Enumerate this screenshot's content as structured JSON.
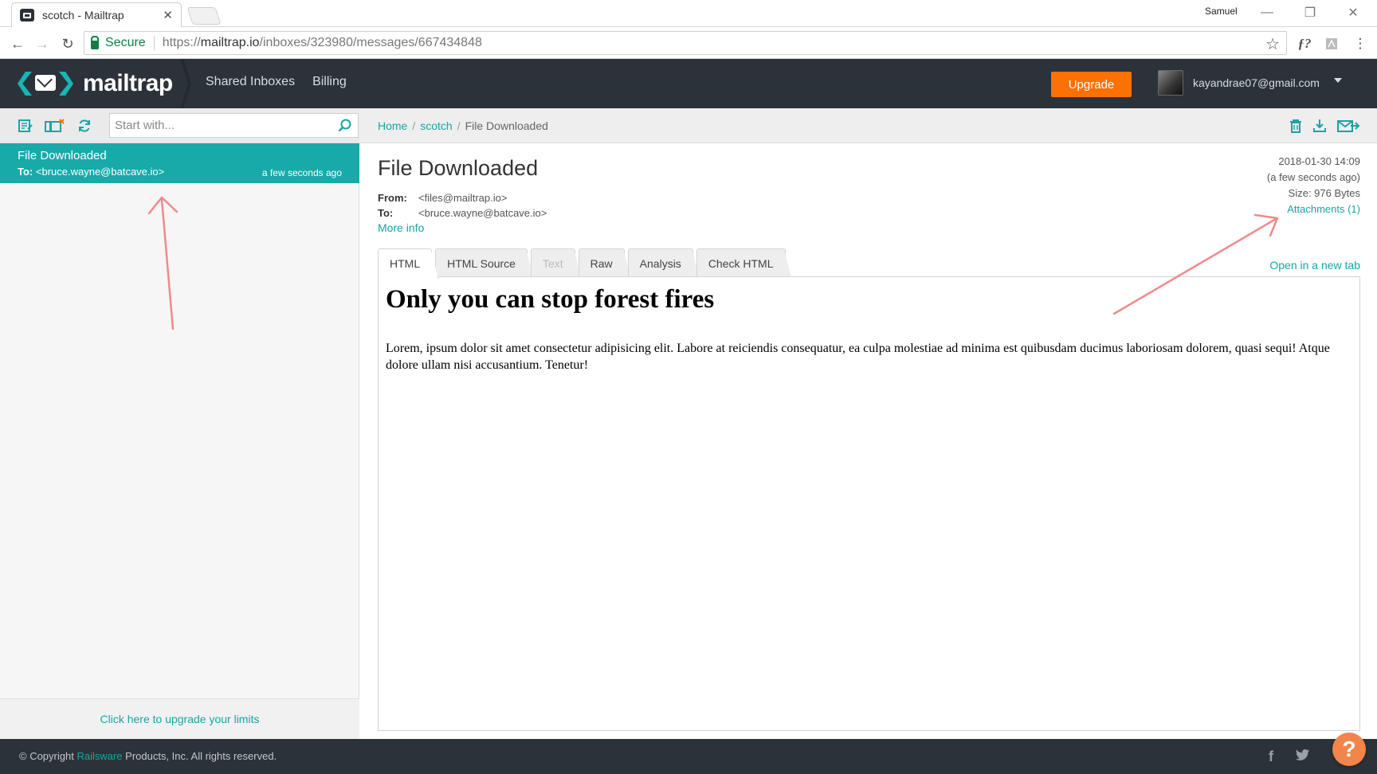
{
  "browser": {
    "tab_title": "scotch - Mailtrap",
    "profile_name": "Samuel",
    "secure_label": "Secure",
    "url_scheme": "https://",
    "url_host": "mailtrap.io",
    "url_path": "/inboxes/323980/messages/667434848"
  },
  "header": {
    "logo_text": "mailtrap",
    "nav": [
      "Shared Inboxes",
      "Billing"
    ],
    "upgrade_label": "Upgrade",
    "user_email": "kayandrae07@gmail.com"
  },
  "sidebar": {
    "search_placeholder": "Start with...",
    "messages": [
      {
        "subject": "File Downloaded",
        "to_label": "To:",
        "to": "<bruce.wayne@batcave.io>",
        "time": "a few seconds ago"
      }
    ],
    "upgrade_limits": "Click here to upgrade your limits"
  },
  "main": {
    "breadcrumb": {
      "home": "Home",
      "inbox": "scotch",
      "current": "File Downloaded"
    },
    "message": {
      "title": "File Downloaded",
      "from_label": "From:",
      "from": "<files@mailtrap.io>",
      "to_label": "To:",
      "to": "<bruce.wayne@batcave.io>",
      "more_info": "More info",
      "date": "2018-01-30 14:09",
      "relative_time": "(a few seconds ago)",
      "size": "Size: 976 Bytes",
      "attachments": "Attachments (1)"
    },
    "tabs": [
      {
        "label": "HTML",
        "state": "active"
      },
      {
        "label": "HTML Source",
        "state": "normal"
      },
      {
        "label": "Text",
        "state": "disabled"
      },
      {
        "label": "Raw",
        "state": "normal"
      },
      {
        "label": "Analysis",
        "state": "normal"
      },
      {
        "label": "Check HTML",
        "state": "normal"
      }
    ],
    "open_new_tab": "Open in a new tab",
    "preview": {
      "heading": "Only you can stop forest fires",
      "body": "Lorem, ipsum dolor sit amet consectetur adipisicing elit. Labore at reiciendis consequatur, ea culpa molestiae ad minima est quibusdam ducimus laboriosam dolorem, quasi sequi! Atque dolore ullam nisi accusantium. Tenetur!"
    }
  },
  "footer": {
    "copyright_prefix": "© Copyright ",
    "company": "Railsware",
    "copyright_suffix": " Products, Inc. All rights reserved."
  },
  "help_label": "?",
  "colors": {
    "accent": "#17aaa9",
    "header_bg": "#2c3239",
    "upgrade": "#fb7103",
    "annotation": "#f08a8a"
  }
}
